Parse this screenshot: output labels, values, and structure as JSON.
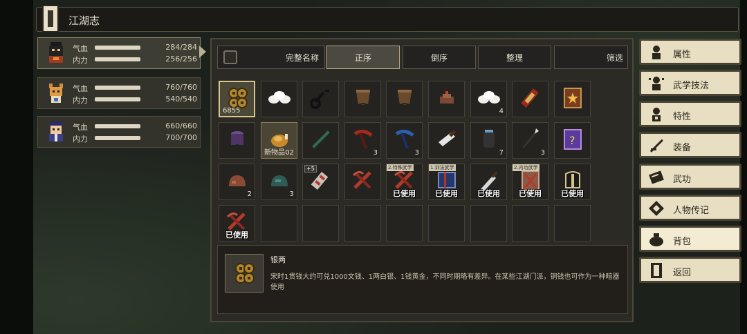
{
  "title": "江湖志",
  "characters": [
    {
      "hp_label": "气血",
      "hp": "284/284",
      "mp_label": "内力",
      "mp": "256/256"
    },
    {
      "hp_label": "气血",
      "hp": "760/760",
      "mp_label": "内力",
      "mp": "540/540"
    },
    {
      "hp_label": "气血",
      "hp": "660/660",
      "mp_label": "内力",
      "mp": "700/700"
    }
  ],
  "sort": {
    "full_name": "完整名称",
    "asc": "正序",
    "desc": "倒序",
    "organize": "整理",
    "filter": "筛选"
  },
  "items": [
    {
      "icon": "copper-coins-icon",
      "qty": "6855",
      "qty_left": true
    },
    {
      "icon": "white-buns-icon",
      "qty": ""
    },
    {
      "icon": "black-key-icon",
      "qty": ""
    },
    {
      "icon": "wooden-cup-icon",
      "qty": ""
    },
    {
      "icon": "wooden-cup-icon",
      "qty": ""
    },
    {
      "icon": "meat-chunk-icon",
      "qty": ""
    },
    {
      "icon": "white-buns-icon",
      "qty": "4"
    },
    {
      "icon": "red-scroll-icon",
      "qty": ""
    },
    {
      "icon": "book-star-icon",
      "qty": ""
    },
    {
      "icon": "purple-pot-icon",
      "qty": ""
    },
    {
      "icon": "roast-chicken-icon",
      "qty": "02",
      "badge": "新物品"
    },
    {
      "icon": "green-staff-icon",
      "qty": ""
    },
    {
      "icon": "red-pickaxe-icon",
      "qty": "3"
    },
    {
      "icon": "blue-pickaxe-icon",
      "qty": "3"
    },
    {
      "icon": "cleaver-icon",
      "qty": ""
    },
    {
      "icon": "jar-icon",
      "qty": "7"
    },
    {
      "icon": "spear-icon",
      "qty": "3"
    },
    {
      "icon": "mystery-book-icon",
      "qty": ""
    },
    {
      "icon": "brown-ore-icon",
      "qty": "2"
    },
    {
      "icon": "teal-ore-icon",
      "qty": "3"
    },
    {
      "icon": "cannon-icon",
      "qty": "",
      "plus": "+5"
    },
    {
      "icon": "red-cross-icon",
      "qty": ""
    },
    {
      "icon": "red-cross-icon",
      "qty": "",
      "tag": "2.特殊武学",
      "used": "已使用"
    },
    {
      "icon": "blue-book-icon",
      "qty": "",
      "tag": "1.训法武学",
      "used": "已使用"
    },
    {
      "icon": "dagger-icon",
      "qty": "",
      "used": "已使用"
    },
    {
      "icon": "red-shield-icon",
      "qty": "",
      "tag": "2.内功武学",
      "used": "已使用"
    },
    {
      "icon": "dark-armor-icon",
      "qty": "",
      "used": "已使用"
    },
    {
      "icon": "red-cross-icon",
      "qty": "",
      "used": "已使用"
    },
    {
      "icon": "",
      "qty": ""
    },
    {
      "icon": "",
      "qty": ""
    },
    {
      "icon": "",
      "qty": ""
    },
    {
      "icon": "",
      "qty": ""
    },
    {
      "icon": "",
      "qty": ""
    },
    {
      "icon": "",
      "qty": ""
    },
    {
      "icon": "",
      "qty": ""
    },
    {
      "icon": "",
      "qty": ""
    }
  ],
  "detail": {
    "name": "银两",
    "text": "宋时1贯钱大约可兑1000文钱、1两白银、1钱黄金，不同时期略有差异。在某些江湖门派，铜钱也可作为一种暗器使用"
  },
  "menu": [
    {
      "label": "属性",
      "icon": "person-icon"
    },
    {
      "label": "武学技法",
      "icon": "martial-person-icon"
    },
    {
      "label": "特性",
      "icon": "trait-person-icon"
    },
    {
      "label": "装备",
      "icon": "sword-icon"
    },
    {
      "label": "武功",
      "icon": "manual-icon"
    },
    {
      "label": "人物传记",
      "icon": "diamond-icon"
    },
    {
      "label": "背包",
      "icon": "bag-icon"
    },
    {
      "label": "返回",
      "icon": "door-icon"
    }
  ]
}
